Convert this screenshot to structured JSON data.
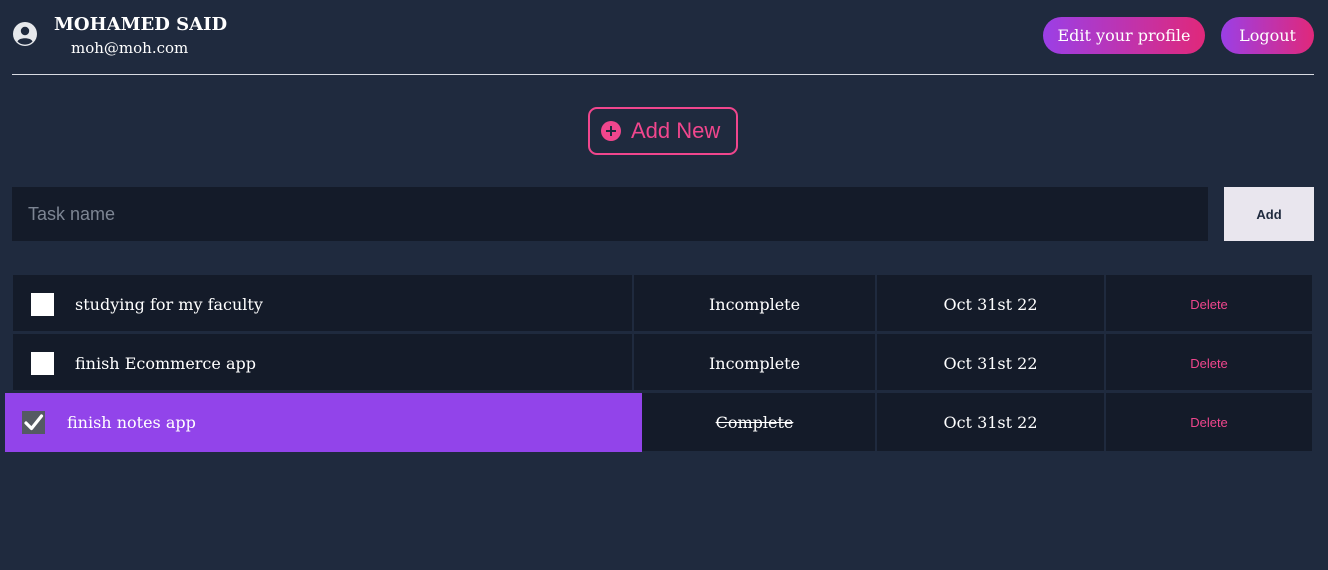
{
  "header": {
    "avatar_icon": "user-circle-icon",
    "user_name": "MOHAMED SAID",
    "user_email": "moh@moh.com",
    "edit_profile_label": "Edit your profile",
    "logout_label": "Logout"
  },
  "add_new": {
    "icon": "plus-circle-icon",
    "label": "Add New"
  },
  "task_form": {
    "placeholder": "Task name",
    "value": "",
    "add_label": "Add"
  },
  "tasks": [
    {
      "title": "studying for my faculty",
      "status": "Incomplete",
      "date": "Oct 31st 22",
      "delete_label": "Delete",
      "checked": false
    },
    {
      "title": "finish Ecommerce app",
      "status": "Incomplete",
      "date": "Oct 31st 22",
      "delete_label": "Delete",
      "checked": false
    },
    {
      "title": "finish notes app",
      "status": "Complete",
      "date": "Oct 31st 22",
      "delete_label": "Delete",
      "checked": true
    }
  ],
  "colors": {
    "background": "#1f2a3e",
    "surface": "#141b29",
    "accent_pink": "#f0468d",
    "accent_purple": "#9244ea",
    "gradient_start": "#9b3fe6",
    "gradient_end": "#e0287a"
  }
}
